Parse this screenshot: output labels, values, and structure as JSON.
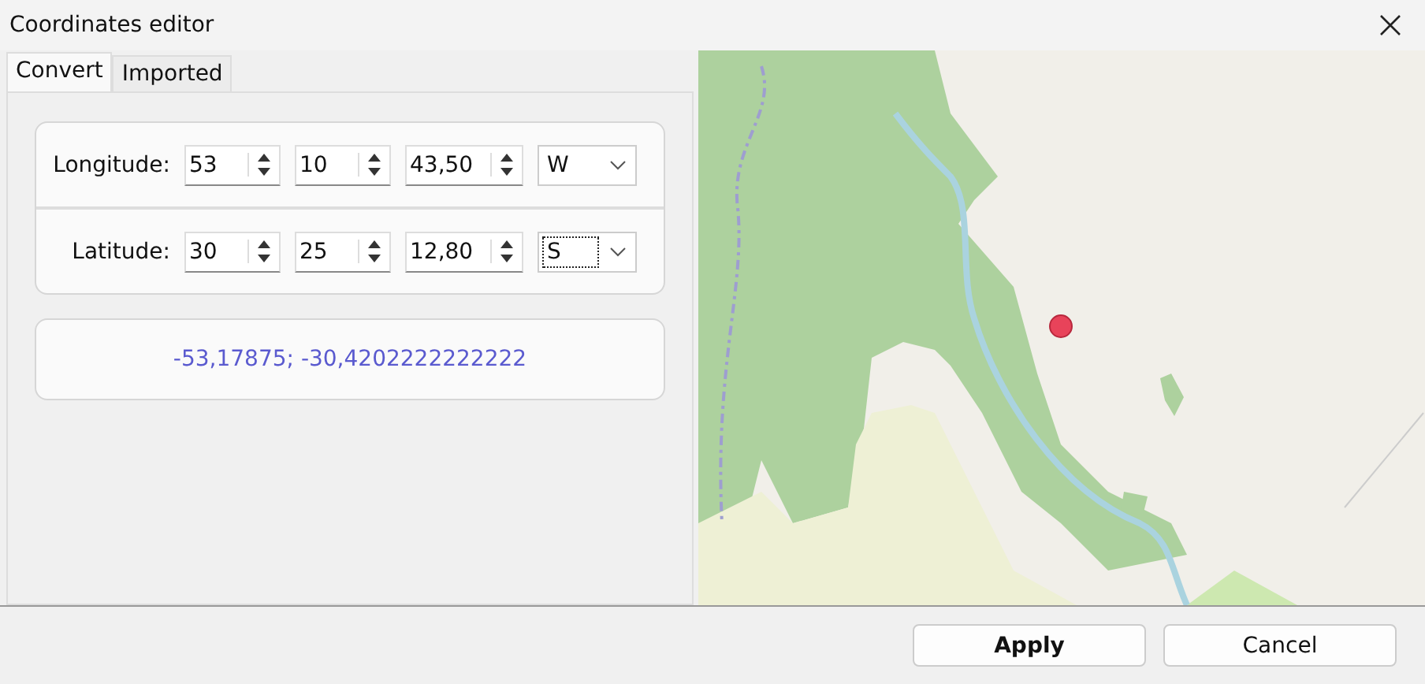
{
  "window": {
    "title": "Coordinates editor"
  },
  "tabs": [
    {
      "label": "Convert",
      "selected": true
    },
    {
      "label": "Imported",
      "selected": false
    }
  ],
  "coordinates": [
    {
      "label": "Longitude:",
      "degrees": "53",
      "minutes": "10",
      "seconds": "43,50",
      "hemisphere": "W",
      "focused": false
    },
    {
      "label": "Latitude:",
      "degrees": "30",
      "minutes": "25",
      "seconds": "12,80",
      "hemisphere": "S",
      "focused": true
    }
  ],
  "result": "-53,17875; -30,4202222222222",
  "buttons": [
    {
      "label": "Apply",
      "default": true
    },
    {
      "label": "Cancel",
      "default": false
    }
  ]
}
